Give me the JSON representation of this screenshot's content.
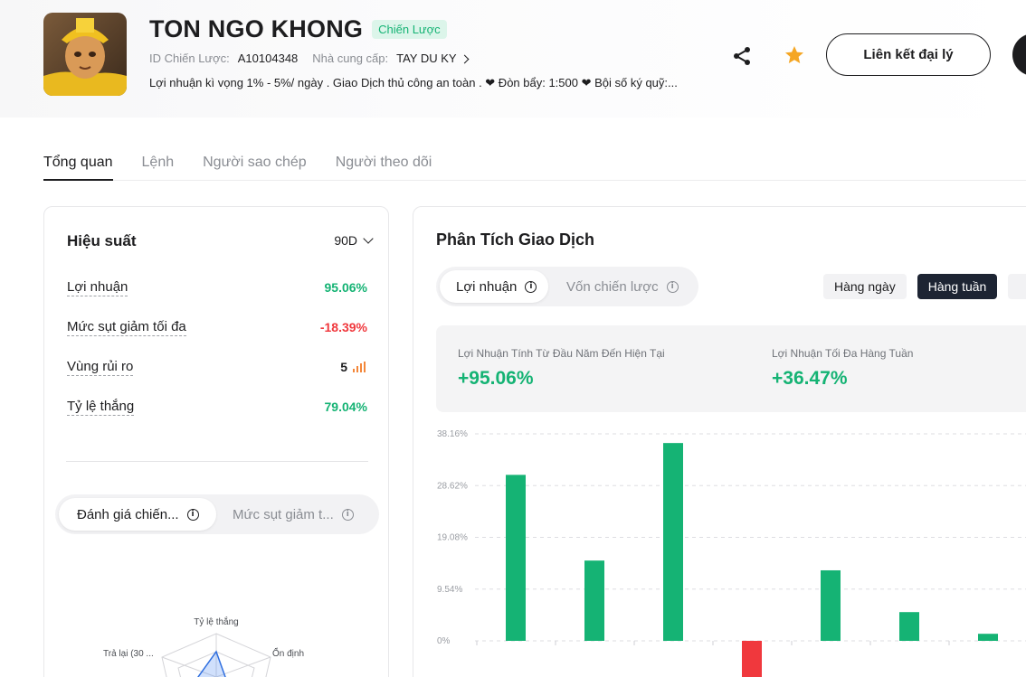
{
  "header": {
    "strategy_name": "TON NGO KHONG",
    "badge": "Chiến Lược",
    "id_label": "ID Chiến Lược:",
    "id_value": "A10104348",
    "provider_label": "Nhà cung cấp:",
    "provider_value": "TAY DU KY",
    "description": "Lợi nhuận kì vọng 1% - 5%/ ngày . Giao Dịch thủ công an toàn . ❤ Đòn bẩy: 1:500 ❤ Bội số ký quỹ:...",
    "agent_button": "Liên kết đại lý",
    "share_icon": "share-icon",
    "star_icon": "star-icon"
  },
  "tabs": [
    {
      "label": "Tổng quan",
      "active": true
    },
    {
      "label": "Lệnh",
      "active": false
    },
    {
      "label": "Người sao chép",
      "active": false
    },
    {
      "label": "Người theo dõi",
      "active": false
    }
  ],
  "performance": {
    "title": "Hiệu suất",
    "period": "90D",
    "metrics": [
      {
        "label": "Lợi nhuận",
        "value": "95.06%"
      },
      {
        "label": "Mức sụt giảm tối đa",
        "value": "-18.39%"
      },
      {
        "label": "Vùng rủi ro",
        "value": "5"
      },
      {
        "label": "Tỷ lệ thắng",
        "value": "79.04%"
      }
    ],
    "segments": [
      "Đánh giá chiến...",
      "Mức sụt giảm t..."
    ],
    "radar_labels": [
      "Tỷ lệ thắng",
      "Ổn định",
      "Trả lại (30 ..."
    ]
  },
  "analysis": {
    "title": "Phân Tích Giao Dịch",
    "segments": [
      "Lợi nhuận",
      "Vốn chiến lược"
    ],
    "period_buttons": [
      {
        "label": "Hàng ngày",
        "active": false
      },
      {
        "label": "Hàng tuần",
        "active": true
      }
    ],
    "stats": [
      {
        "label": "Lợi Nhuận Tính Từ Đầu Năm Đến Hiện Tại",
        "value": "+95.06%"
      },
      {
        "label": "Lợi Nhuận Tối Đa Hàng Tuần",
        "value": "+36.47%"
      }
    ]
  },
  "colors": {
    "positive": "#15b374",
    "negative": "#f0383d",
    "risk": "#f3873a",
    "star": "#f5a623",
    "dark": "#1d2433"
  },
  "chart_data": {
    "type": "bar",
    "y_ticks": [
      "38.16%",
      "28.62%",
      "19.08%",
      "9.54%",
      "0%"
    ],
    "ylim": [
      -7,
      38.16
    ],
    "values": [
      30.6,
      14.8,
      36.47,
      -6.9,
      13.0,
      5.3,
      1.3
    ]
  }
}
